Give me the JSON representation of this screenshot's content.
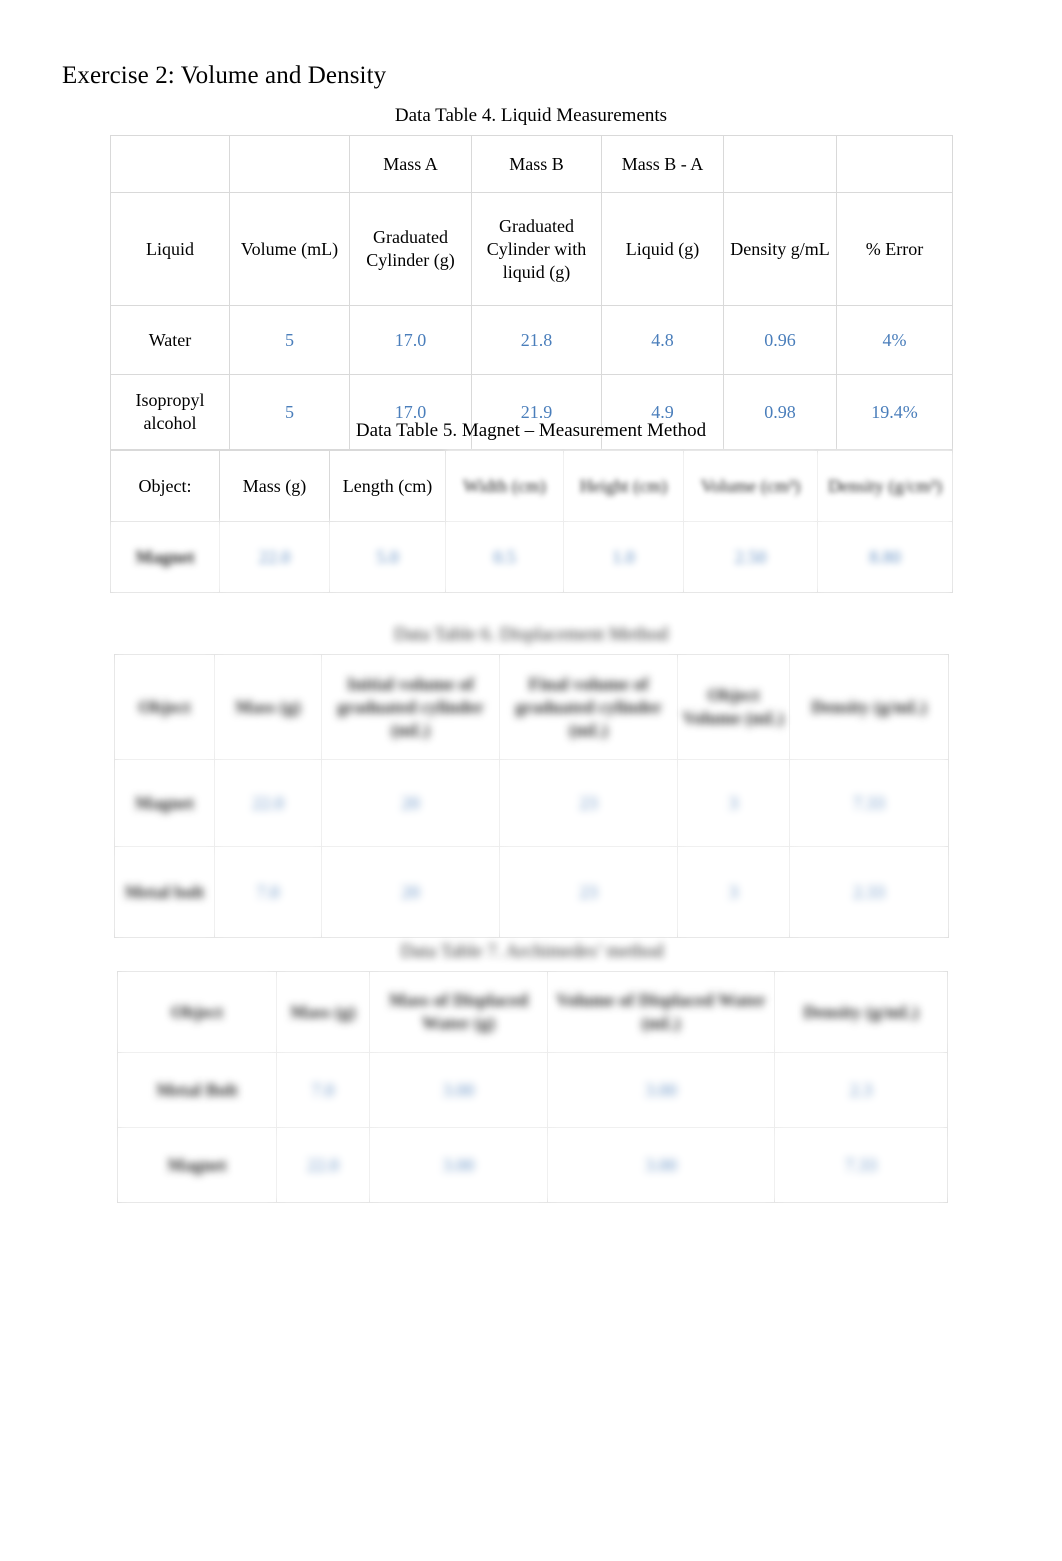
{
  "document": {
    "title": "Exercise 2: Volume and Density"
  },
  "table4": {
    "caption": "Data Table 4.  Liquid Measurements",
    "group_header": [
      "",
      "",
      "Mass A",
      "Mass B",
      "Mass B - A",
      "",
      ""
    ],
    "headers": [
      "Liquid",
      "Volume (mL)",
      "Graduated Cylinder (g)",
      "Graduated Cylinder with liquid (g)",
      "Liquid (g)",
      "Density g/mL",
      "% Error"
    ],
    "rows": [
      {
        "liquid": "Water",
        "volume_ml": "5",
        "mass_a_g": "17.0",
        "mass_b_g": "21.8",
        "mass_b_minus_a_g": "4.8",
        "density_g_per_ml": "0.96",
        "percent_error": "4%"
      },
      {
        "liquid": "Isopropyl alcohol",
        "volume_ml": "5",
        "mass_a_g": "17.0",
        "mass_b_g": "21.9",
        "mass_b_minus_a_g": "4.9",
        "density_g_per_ml": "0.98",
        "percent_error": "19.4%"
      }
    ]
  },
  "table5": {
    "caption": "Data Table 5.  Magnet – Measurement Method",
    "headers": [
      "Object:",
      "Mass (g)",
      "Length (cm)",
      "Width (cm)",
      "Height (cm)",
      "Volume (cm³)",
      "Density (g/cm³)"
    ],
    "rows": [
      {
        "object": "Magnet",
        "mass_g": "22.0",
        "length_cm": "5.0",
        "width_cm": "0.5",
        "height_cm": "1.0",
        "volume_cm3": "2.50",
        "density_g_cm3": "8.80"
      }
    ]
  },
  "table6": {
    "caption": "Data Table 6.  Displacement Method",
    "headers": [
      "Object",
      "Mass (g)",
      "Initial volume of graduated cylinder (mL)",
      "Final volume of graduated cylinder (mL)",
      "Object Volume (mL)",
      "Density (g/mL)"
    ],
    "rows": [
      {
        "object": "Magnet",
        "mass_g": "22.0",
        "initial_volume_ml": "20",
        "final_volume_ml": "23",
        "object_volume_ml": "3",
        "density_g_ml": "7.33"
      },
      {
        "object": "Metal bolt",
        "mass_g": "7.0",
        "initial_volume_ml": "20",
        "final_volume_ml": "23",
        "object_volume_ml": "3",
        "density_g_ml": "2.33"
      }
    ]
  },
  "table7": {
    "caption": "Data Table 7.  Archimedes’ method",
    "headers": [
      "Object",
      "Mass (g)",
      "Mass of Displaced Water (g)",
      "Volume of Displaced Water (mL)",
      "Density (g/mL)"
    ],
    "rows": [
      {
        "object": "Metal Bolt",
        "mass_g": "7.0",
        "mass_displaced_water_g": "3.00",
        "volume_displaced_water_ml": "3.00",
        "density_g_ml": "2.3"
      },
      {
        "object": "Magnet",
        "mass_g": "22.0",
        "mass_displaced_water_g": "3.00",
        "volume_displaced_water_ml": "3.00",
        "density_g_ml": "7.33"
      }
    ]
  },
  "colors": {
    "value_blue": "#4a7ebb",
    "border_gray": "#d9d9d9",
    "text_black": "#000000",
    "page_background": "#ffffff"
  }
}
